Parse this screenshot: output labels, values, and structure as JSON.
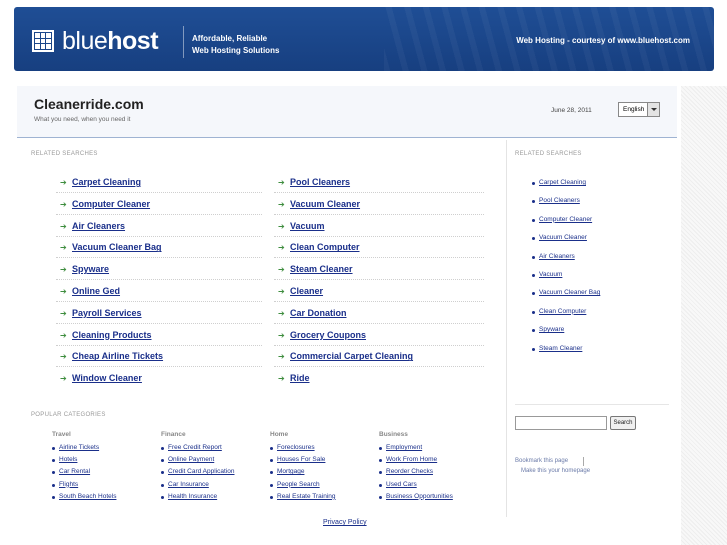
{
  "header": {
    "logo_text_light": "blue",
    "logo_text_bold": "host",
    "tagline_line1": "Affordable, Reliable",
    "tagline_line2": "Web Hosting Solutions",
    "courtesy": "Web Hosting - courtesy of www.bluehost.com",
    "banner_color": "#1f4e95"
  },
  "site": {
    "title": "Cleanerride.com",
    "subtitle": "What you need, when you need it",
    "date": "June 28, 2011",
    "language_selected": "English"
  },
  "main": {
    "related_label": "RELATED SEARCHES",
    "left_links": [
      "Carpet Cleaning",
      "Computer Cleaner",
      "Air Cleaners",
      "Vacuum Cleaner Bag",
      "Spyware",
      "Online Ged",
      "Payroll Services",
      "Cleaning Products",
      "Cheap Airline Tickets",
      "Window Cleaner"
    ],
    "right_links": [
      "Pool Cleaners",
      "Vacuum Cleaner",
      "Vacuum",
      "Clean Computer",
      "Steam Cleaner",
      "Cleaner",
      "Car Donation",
      "Grocery Coupons",
      "Commercial Carpet Cleaning",
      "Ride"
    ],
    "arrow_glyph": "➔",
    "arrow_color": "#3e8d3e",
    "link_color": "#1a2f8a"
  },
  "sidebar": {
    "related_label": "RELATED SEARCHES",
    "links": [
      "Carpet Cleaning",
      "Pool Cleaners",
      "Computer Cleaner",
      "Vacuum Cleaner",
      "Air Cleaners",
      "Vacuum",
      "Vacuum Cleaner Bag",
      "Clean Computer",
      "Spyware",
      "Steam Cleaner"
    ],
    "search_button": "Search",
    "bookmark": "Bookmark this page",
    "homepage": "Make this your homepage"
  },
  "popular": {
    "label": "POPULAR CATEGORIES",
    "columns": [
      {
        "heading": "Travel",
        "items": [
          "Airline Tickets",
          "Hotels",
          "Car Rental",
          "Flights",
          "South Beach Hotels"
        ]
      },
      {
        "heading": "Finance",
        "items": [
          "Free Credit Report",
          "Online Payment",
          "Credit Card Application",
          "Car Insurance",
          "Health Insurance"
        ]
      },
      {
        "heading": "Home",
        "items": [
          "Foreclosures",
          "Houses For Sale",
          "Mortgage",
          "People Search",
          "Real Estate Training"
        ]
      },
      {
        "heading": "Business",
        "items": [
          "Employment",
          "Work From Home",
          "Reorder Checks",
          "Used Cars",
          "Business Opportunities"
        ]
      }
    ]
  },
  "footer": {
    "privacy": "Privacy Policy"
  }
}
